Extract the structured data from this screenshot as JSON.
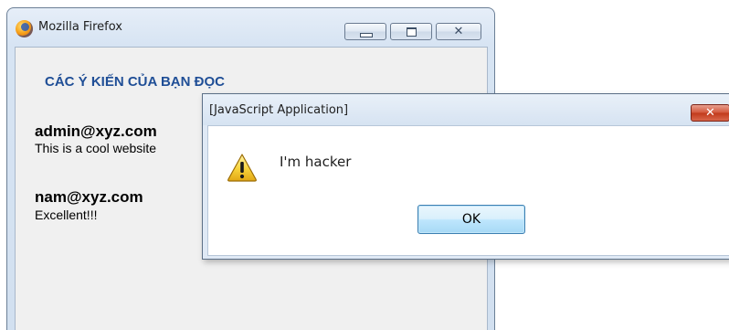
{
  "browser": {
    "title": "Mozilla Firefox",
    "icons": {
      "app": "firefox-logo-icon",
      "minimize": "minimize-icon",
      "maximize": "maximize-icon",
      "close": "close-icon"
    },
    "close_glyph": "✕"
  },
  "page": {
    "heading": "CÁC Ý KIẾN CỦA BẠN ĐỌC",
    "comments": [
      {
        "email": "admin@xyz.com",
        "text": "This is a cool website"
      },
      {
        "email": "nam@xyz.com",
        "text": "Excellent!!!"
      }
    ],
    "heading_color": "#1f4e96"
  },
  "dialog": {
    "title": "[JavaScript Application]",
    "message": "I'm hacker",
    "ok_label": "OK",
    "close_glyph": "✕",
    "icon": "warning-icon",
    "close_color": "#c13a1b"
  }
}
